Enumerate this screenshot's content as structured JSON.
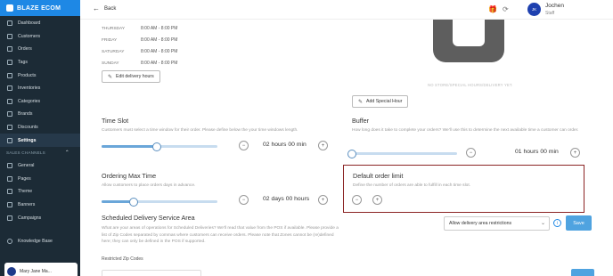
{
  "brand": {
    "name": "BLAZE ECOM"
  },
  "sidebar": {
    "items": [
      {
        "label": "Dashboard",
        "icon": "home-icon"
      },
      {
        "label": "Customers",
        "icon": "users-icon"
      },
      {
        "label": "Orders",
        "icon": "cart-icon"
      },
      {
        "label": "Tags",
        "icon": "tag-icon"
      },
      {
        "label": "Products",
        "icon": "box-icon"
      },
      {
        "label": "Inventories",
        "icon": "inventory-icon"
      },
      {
        "label": "Categories",
        "icon": "categories-icon"
      },
      {
        "label": "Brands",
        "icon": "brand-icon"
      },
      {
        "label": "Discounts",
        "icon": "discount-icon"
      },
      {
        "label": "Settings",
        "icon": "gear-icon",
        "active": true
      }
    ],
    "section_label": "SALES CHANNELS",
    "channel_items": [
      {
        "label": "General",
        "icon": "general-icon"
      },
      {
        "label": "Pages",
        "icon": "pages-icon"
      },
      {
        "label": "Theme",
        "icon": "theme-icon"
      },
      {
        "label": "Banners",
        "icon": "banner-icon"
      },
      {
        "label": "Campaigns",
        "icon": "campaign-icon"
      }
    ],
    "knowledge_base": "Knowledge Base",
    "user_card_name": "Mary Jane Ma..."
  },
  "topbar": {
    "back_label": "Back",
    "user_initials": "JK",
    "user_name": "Jochen",
    "user_role": "Staff"
  },
  "hours": [
    {
      "day": "THURSDAY",
      "time": "8:00 AM - 8:00 PM"
    },
    {
      "day": "FRIDAY",
      "time": "8:00 AM - 8:00 PM"
    },
    {
      "day": "SATURDAY",
      "time": "8:00 AM - 8:00 PM"
    },
    {
      "day": "SUNDAY",
      "time": "8:00 AM - 8:00 PM"
    }
  ],
  "edit_delivery_hours": "Edit delivery hours",
  "no_store_text": "NO STORE/SPECIAL HOURS/DELIVERY YET.",
  "add_special_hour": "Add Special Hour",
  "time_slot": {
    "title": "Time Slot",
    "desc": "Customers must select a time window for their order. Please define below the your time windows length.",
    "value": "02 hours 00 min",
    "slider_fraction": 0.48
  },
  "buffer": {
    "title": "Buffer",
    "desc": "How long does it take to complete your orders? We'll use this to determine the next available time a customer can order.",
    "value": "01 hours 00 min",
    "slider_fraction": 0.0
  },
  "ordering_max_time": {
    "title": "Ordering Max Time",
    "desc": "Allow customers to place orders days in advance.",
    "value": "02 days 00 hours",
    "slider_fraction": 0.28
  },
  "default_order_limit": {
    "title": "Default order limit",
    "desc": "Define the number of orders are able to fulfill in each time slot."
  },
  "scheduled_area": {
    "title": "Scheduled Delivery Service Area",
    "desc": "What are your areas of operations for Scheduled Deliveries? We'll read that value from the POS if available. Please provide a list of Zip Codes separated by commas where customers can receive orders. Please note that Zones cannot be (re)defined here; they can only be defined in the POS if supported.",
    "select_value": "Allow delivery area restrictions",
    "save_label": "Save"
  },
  "restricted_zip_codes_label": "Restricted Zip Codes",
  "colors": {
    "sidebar": "#1c2b36",
    "brand": "#1e88e5",
    "highlight_border": "#8b2424",
    "primary": "#4fa3e0"
  }
}
